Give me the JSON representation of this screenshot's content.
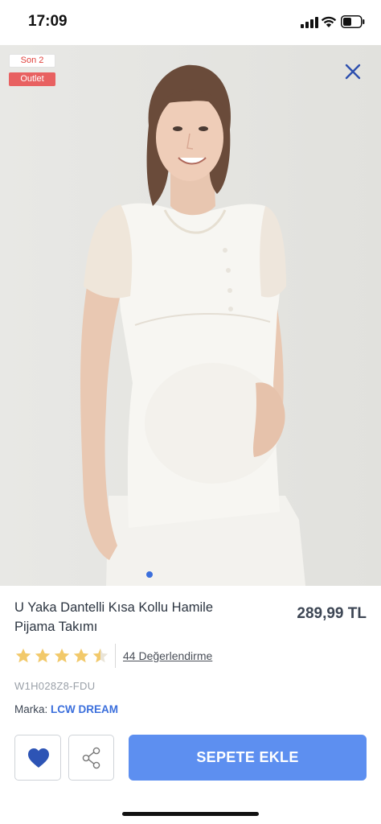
{
  "status_bar": {
    "time": "17:09"
  },
  "badges": {
    "stock": "Son 2",
    "outlet": "Outlet"
  },
  "product": {
    "title": "U Yaka Dantelli Kısa Kollu Hamile Pijama Takımı",
    "price": "289,99 TL",
    "rating": 4.5,
    "rating_max": 5,
    "reviews_label": "44 Değerlendirme",
    "code": "W1H028Z8-FDU",
    "brand_label": "Marka:",
    "brand_name": "LCW DREAM"
  },
  "gallery": {
    "current_page": 1
  },
  "actions": {
    "add_to_cart_label": "SEPETE EKLE"
  },
  "colors": {
    "accent": "#5d8ff0",
    "brand_link": "#3b6fdc",
    "heart": "#2d54b5",
    "star": "#f2c96a",
    "outlet_badge": "#e86161",
    "close_icon": "#2d4fae"
  },
  "icons": {
    "close": "close-icon",
    "favorite": "heart-icon",
    "share": "share-icon",
    "star": "star-icon"
  }
}
